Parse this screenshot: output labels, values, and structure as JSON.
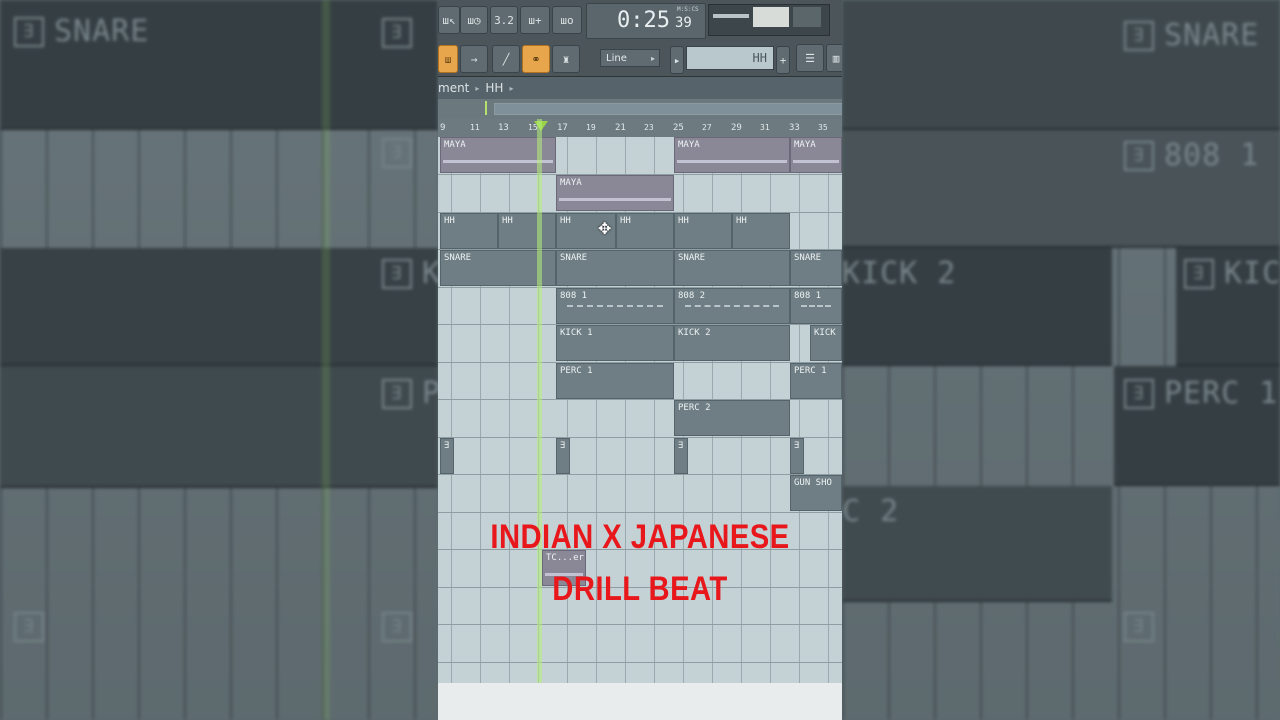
{
  "background": {
    "left_labels": [
      "SNARE",
      "KICK",
      "PERC"
    ],
    "right_labels": [
      "SNARE",
      "808 1",
      "KICK 2",
      "PERC 1",
      "C 2"
    ],
    "right_mid_label": "KICK"
  },
  "toolbar": {
    "time_main": "0:25",
    "time_cs": "39",
    "time_unit": "M:S:CS",
    "btn1": "ш↖",
    "btn2": "ш◷",
    "btn3": "3.2",
    "btn4": "ш+",
    "btn5": "шо",
    "snap_value": "Line",
    "pattern_name": "HH",
    "plus_label": "+"
  },
  "breadcrumb": {
    "part1": "ment",
    "part2": "HH"
  },
  "ruler": [
    "9",
    "11",
    "13",
    "15",
    "17",
    "19",
    "21",
    "23",
    "25",
    "27",
    "29",
    "31",
    "33",
    "35"
  ],
  "clips": [
    {
      "label": "MAYA"
    },
    {
      "label": "MAYA"
    },
    {
      "label": "MAYA"
    },
    {
      "label": "MAYA"
    },
    {
      "label": "HH"
    },
    {
      "label": "HH"
    },
    {
      "label": "HH"
    },
    {
      "label": "HH"
    },
    {
      "label": "HH"
    },
    {
      "label": "HH"
    },
    {
      "label": "SNARE"
    },
    {
      "label": "SNARE"
    },
    {
      "label": "SNARE"
    },
    {
      "label": "SNARE"
    },
    {
      "label": "808 1"
    },
    {
      "label": "808 2"
    },
    {
      "label": "808 1"
    },
    {
      "label": "KICK 1"
    },
    {
      "label": "KICK 2"
    },
    {
      "label": "KICK"
    },
    {
      "label": "PERC 1"
    },
    {
      "label": "PERC 1"
    },
    {
      "label": "PERC 2"
    },
    {
      "label": "GUN SHO"
    },
    {
      "label": "TC...er"
    }
  ],
  "overlay": {
    "line1": "INDIAN X JAPANESE",
    "line2": "DRILL BEAT"
  },
  "colors": {
    "overlay_text": "#e8171b",
    "playhead": "#9ad34a",
    "accent_button": "#e8a64c"
  }
}
